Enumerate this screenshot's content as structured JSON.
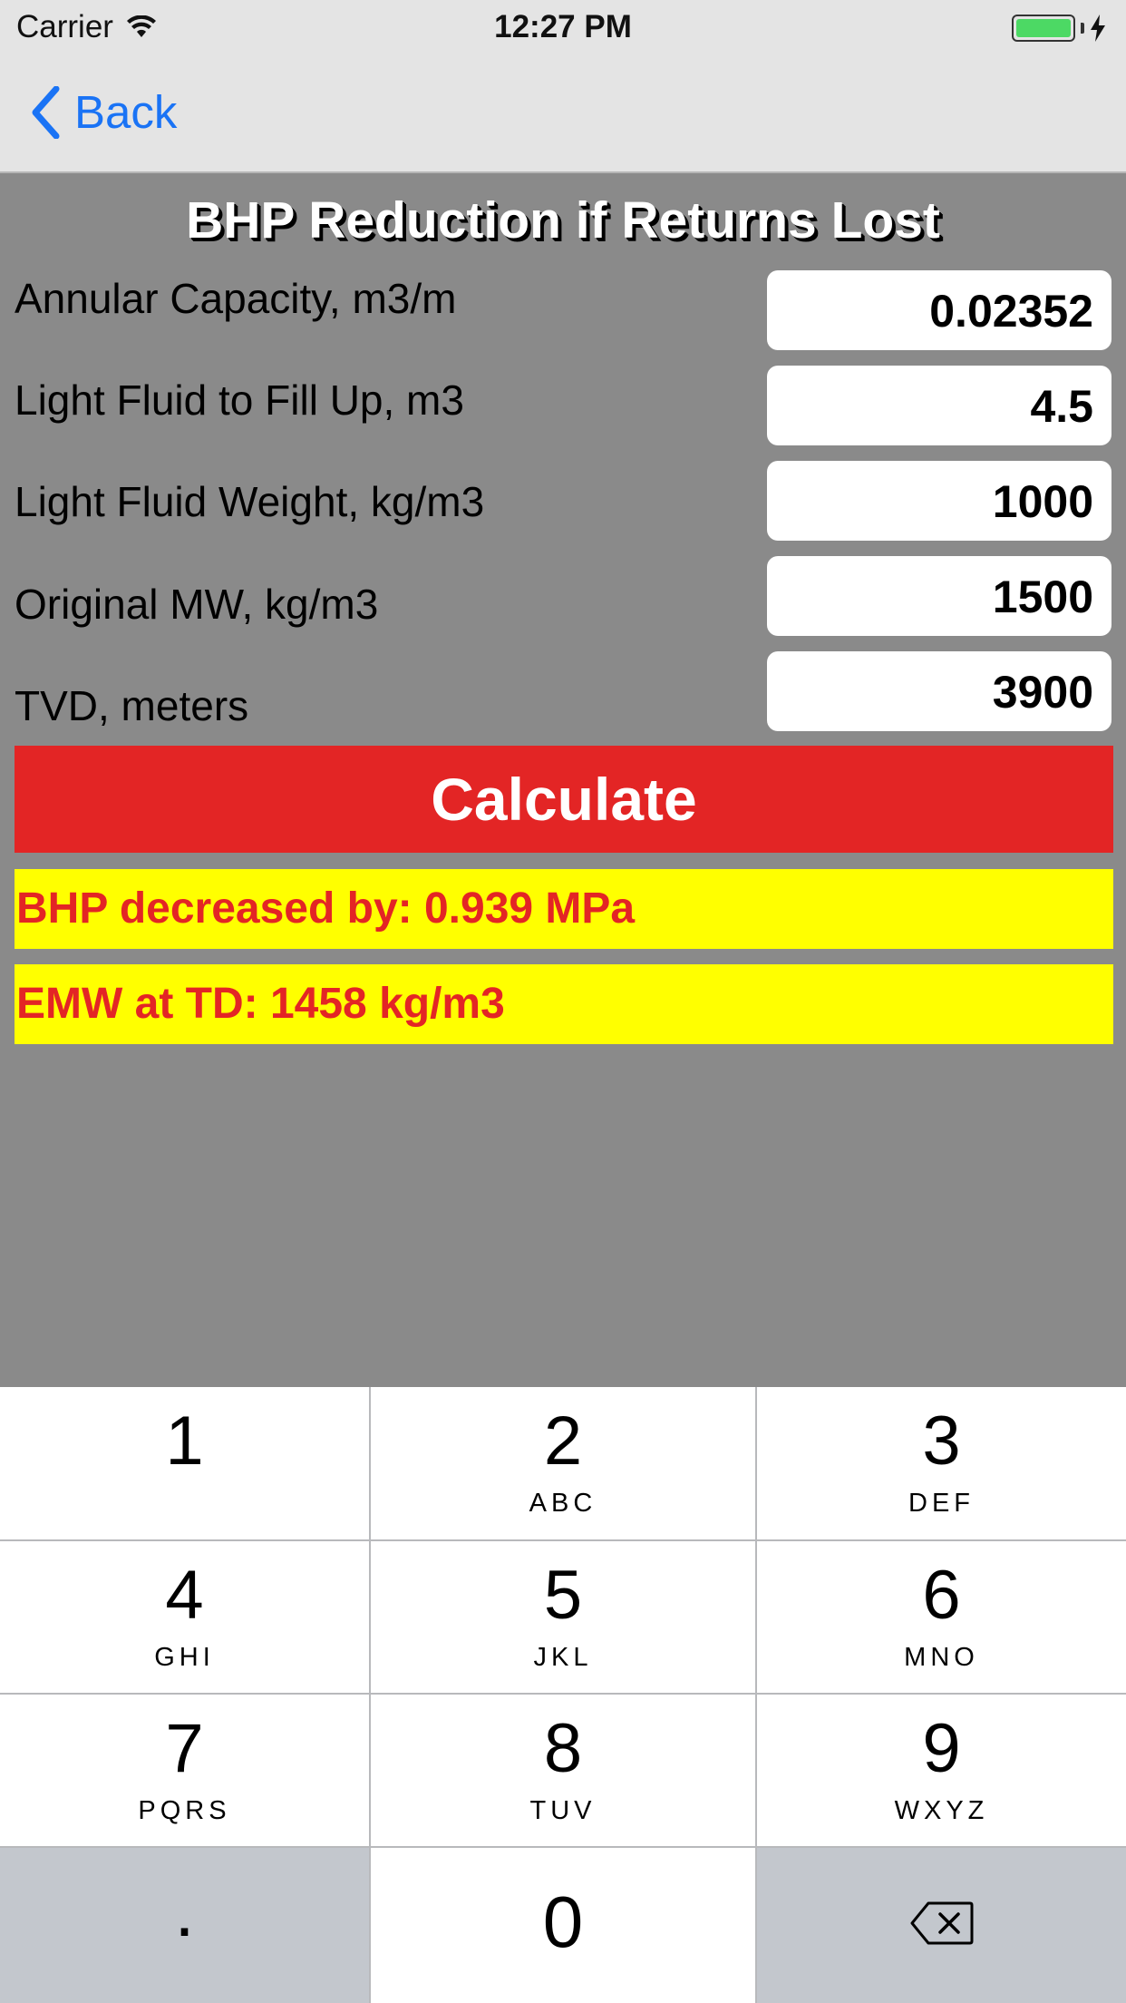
{
  "status_bar": {
    "carrier": "Carrier",
    "time": "12:27 PM"
  },
  "nav": {
    "back_label": "Back"
  },
  "title": "BHP Reduction if Returns Lost",
  "fields": [
    {
      "label": "Annular Capacity, m3/m",
      "value": "0.02352"
    },
    {
      "label": "Light Fluid to Fill Up, m3",
      "value": "4.5"
    },
    {
      "label": "Light Fluid Weight, kg/m3",
      "value": "1000"
    },
    {
      "label": "Original MW, kg/m3",
      "value": "1500"
    },
    {
      "label": "TVD, meters",
      "value": "3900"
    }
  ],
  "calculate_label": "Calculate",
  "results": {
    "bhp": "BHP decreased by: 0.939 MPa",
    "emw": "EMW at TD: 1458 kg/m3"
  },
  "keypad": {
    "keys": [
      {
        "num": "1",
        "letters": ""
      },
      {
        "num": "2",
        "letters": "ABC"
      },
      {
        "num": "3",
        "letters": "DEF"
      },
      {
        "num": "4",
        "letters": "GHI"
      },
      {
        "num": "5",
        "letters": "JKL"
      },
      {
        "num": "6",
        "letters": "MNO"
      },
      {
        "num": "7",
        "letters": "PQRS"
      },
      {
        "num": "8",
        "letters": "TUV"
      },
      {
        "num": "9",
        "letters": "WXYZ"
      }
    ],
    "decimal": ".",
    "zero": "0"
  },
  "colors": {
    "background": "#8a8a8a",
    "calculate": "#e32525",
    "result_bg": "#ffff00",
    "result_text": "#e32525",
    "link": "#1a73f5"
  }
}
